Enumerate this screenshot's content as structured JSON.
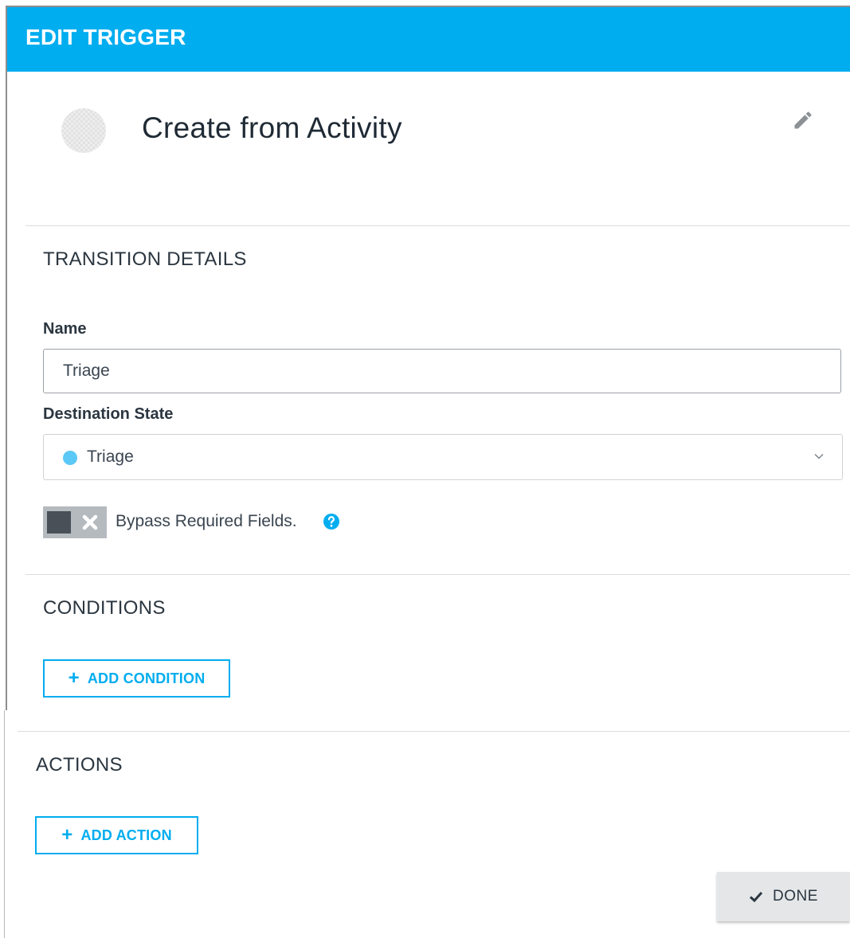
{
  "header": {
    "title": "EDIT TRIGGER"
  },
  "trigger": {
    "name": "Create from Activity",
    "edit_icon": "pencil-icon"
  },
  "transition_details": {
    "section_title": "TRANSITION DETAILS",
    "name_label": "Name",
    "name_value": "Triage",
    "destination_label": "Destination State",
    "destination_value": "Triage",
    "destination_dot_color": "#5bc8f5",
    "bypass_label": "Bypass Required Fields.",
    "bypass_enabled": false
  },
  "conditions": {
    "section_title": "CONDITIONS",
    "add_label": "ADD CONDITION"
  },
  "actions": {
    "section_title": "ACTIONS",
    "add_label": "ADD ACTION"
  },
  "footer": {
    "done_label": "DONE"
  },
  "colors": {
    "accent": "#00adef",
    "header_bg": "#00adef"
  }
}
